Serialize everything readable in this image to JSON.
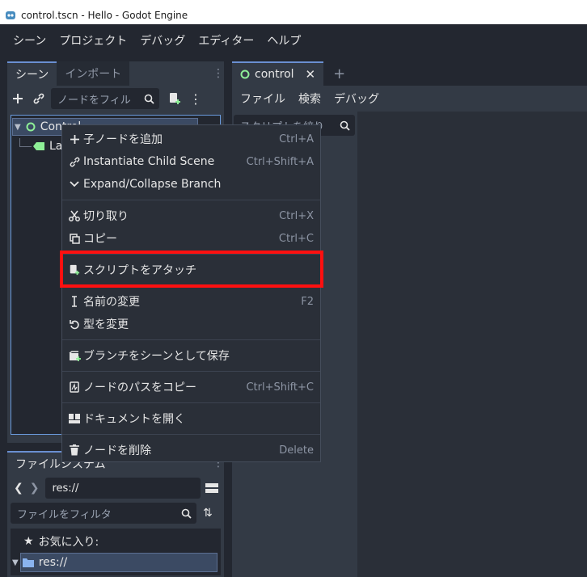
{
  "window": {
    "title": "control.tscn - Hello - Godot Engine"
  },
  "menubar": [
    "シーン",
    "プロジェクト",
    "デバッグ",
    "エディター",
    "ヘルプ"
  ],
  "scene_dock": {
    "tabs": [
      "シーン",
      "インポート"
    ],
    "filter_placeholder": "ノードをフィル",
    "tree": [
      {
        "label": "Control",
        "icon": "control-node-icon"
      },
      {
        "label": "La",
        "icon": "label-node-icon"
      }
    ]
  },
  "editor": {
    "tab_label": "control",
    "menu": [
      "ファイル",
      "検索",
      "デバッグ"
    ],
    "script_filter_placeholder": "スクリプトを絞り"
  },
  "filesystem_dock": {
    "tab": "ファイルシステム",
    "path": "res://",
    "filter_placeholder": "ファイルをフィルタ",
    "favorites_label": "お気に入り:",
    "root_label": "res://"
  },
  "context_menu": {
    "items": [
      {
        "label": "子ノードを追加",
        "shortcut": "Ctrl+A",
        "icon": "plus-icon"
      },
      {
        "label": "Instantiate Child Scene",
        "shortcut": "Ctrl+Shift+A",
        "icon": "link-icon"
      },
      {
        "label": "Expand/Collapse Branch",
        "shortcut": "",
        "icon": "chevron-down-icon"
      },
      {
        "label": "切り取り",
        "shortcut": "Ctrl+X",
        "icon": "scissors-icon"
      },
      {
        "label": "コピー",
        "shortcut": "Ctrl+C",
        "icon": "copy-icon"
      },
      {
        "label": "スクリプトをアタッチ",
        "shortcut": "",
        "icon": "script-add-icon"
      },
      {
        "label": "名前の変更",
        "shortcut": "F2",
        "icon": "text-cursor-icon"
      },
      {
        "label": "型を変更",
        "shortcut": "",
        "icon": "rotate-icon"
      },
      {
        "label": "ブランチをシーンとして保存",
        "shortcut": "",
        "icon": "save-scene-icon"
      },
      {
        "label": "ノードのパスをコピー",
        "shortcut": "Ctrl+Shift+C",
        "icon": "copy-path-icon"
      },
      {
        "label": "ドキュメントを開く",
        "shortcut": "",
        "icon": "doc-icon"
      },
      {
        "label": "ノードを削除",
        "shortcut": "Delete",
        "icon": "trash-icon"
      }
    ]
  },
  "colors": {
    "highlight_box": "#ff1010",
    "accent": "#6a8fd1",
    "control_node": "#8eef97",
    "label_node": "#8eef97"
  }
}
